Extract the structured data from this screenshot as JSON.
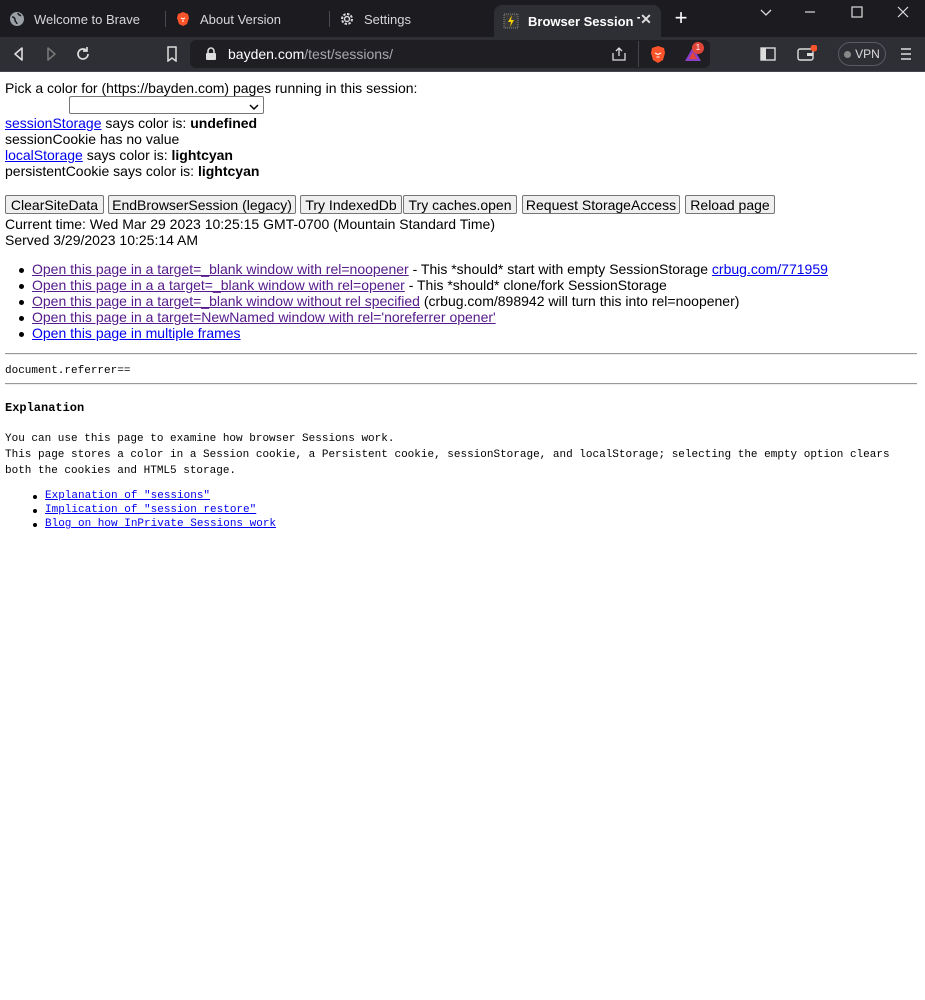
{
  "tabs": [
    {
      "title": "Welcome to Brave",
      "icon": "globe-icon"
    },
    {
      "title": "About Version",
      "icon": "brave-lion-icon"
    },
    {
      "title": "Settings",
      "icon": "gear-icon"
    },
    {
      "title": "Browser Session Tes",
      "icon": "lightning-favicon-icon",
      "active": true
    }
  ],
  "window_controls": {
    "minimize": "minimize-icon",
    "maximize": "maximize-icon",
    "close": "close-icon",
    "tab_list": "chevron-down-icon"
  },
  "toolbar": {
    "url_host": "bayden.com",
    "url_path": "/test/sessions/",
    "rewards_badge": "1",
    "vpn_label": "VPN"
  },
  "page": {
    "pick_label": "Pick a color for (https://bayden.com) pages running in this session:",
    "color_select_value": "",
    "session_storage_link": "sessionStorage",
    "session_storage_text": " says color is: ",
    "session_storage_value": "undefined",
    "session_cookie_text": "sessionCookie has no value",
    "local_storage_link": "localStorage",
    "local_storage_text": " says color is: ",
    "local_storage_value": "lightcyan",
    "persistent_cookie_text": "persistentCookie says color is: ",
    "persistent_cookie_value": "lightcyan",
    "buttons": {
      "clear": "ClearSiteData",
      "end_session": "EndBrowserSession (legacy)",
      "indexeddb": "Try IndexedDb",
      "caches": "Try caches.open",
      "storage_access": "Request StorageAccess",
      "reload": "Reload page"
    },
    "current_time": "Current time: Wed Mar 29 2023 10:25:15 GMT-0700 (Mountain Standard Time)",
    "served": "Served 3/29/2023 10:25:14 AM",
    "links": [
      {
        "link": "Open this page in a target=_blank window with rel=noopener",
        "suffix": " - This *should* start with empty SessionStorage ",
        "extra_link": "crbug.com/771959"
      },
      {
        "link": "Open this page in a a target=_blank window with rel=opener",
        "suffix": " - This *should* clone/fork SessionStorage"
      },
      {
        "link": "Open this page in a target=_blank window without rel specified",
        "suffix": " (crbug.com/898942 will turn this into rel=noopener)"
      },
      {
        "link": "Open this page in a target=NewNamed window with rel='noreferrer opener'",
        "suffix": ""
      },
      {
        "link": "Open this page in multiple frames",
        "suffix": ""
      }
    ],
    "referrer": "document.referrer==",
    "explanation_heading": "Explanation",
    "explanation_line1": "You can use this page to examine how browser Sessions work.",
    "explanation_line2": "This page stores a color in a Session cookie, a Persistent cookie, sessionStorage, and localStorage; selecting the empty option clears",
    "explanation_line3": "both the cookies and HTML5 storage.",
    "explanation_links": [
      "Explanation of \"sessions\"",
      "Implication of \"session restore\"",
      "Blog on how InPrivate Sessions work"
    ]
  }
}
